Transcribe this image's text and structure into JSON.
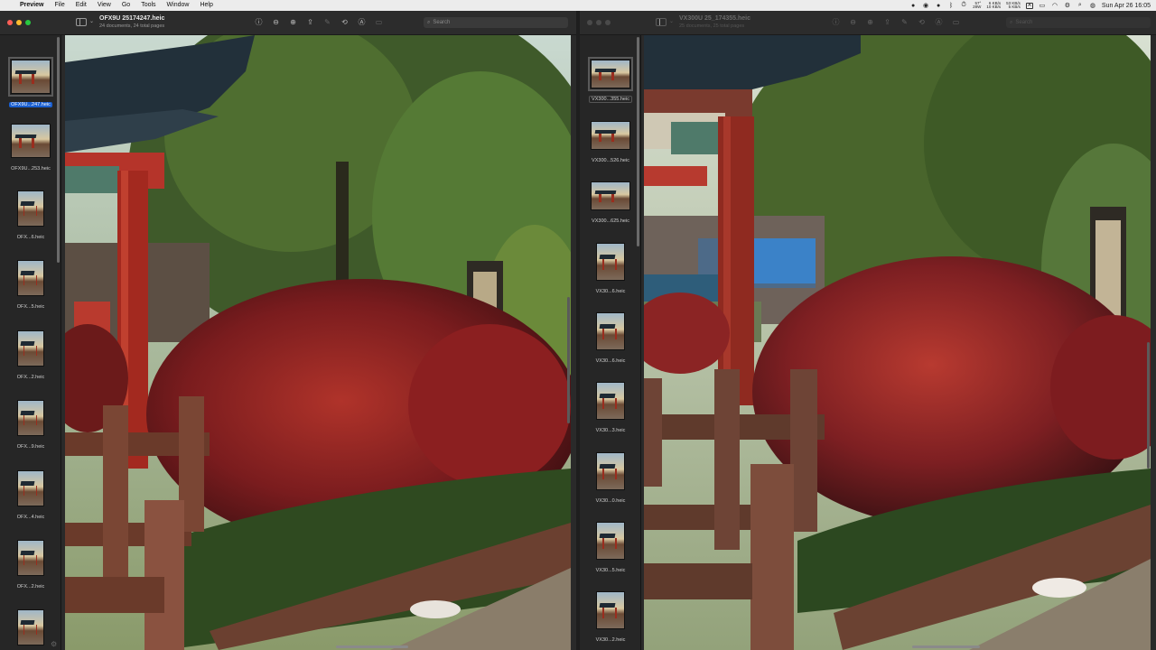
{
  "menubar": {
    "apple_icon": "apple-icon",
    "app_name": "Preview",
    "items": [
      "File",
      "Edit",
      "View",
      "Go",
      "Tools",
      "Window",
      "Help"
    ],
    "status": {
      "cpu_top": "57°",
      "cpu_bottom": "28W",
      "net1_top": "6 KB/s",
      "net1_bottom": "10 KB/s",
      "net2_top": "53 KB/s",
      "net2_bottom": "5 KB/s",
      "lang": "A",
      "clock": "Sun Apr 26  16:05"
    }
  },
  "left_window": {
    "title": "OFX9U 25174247.heic",
    "subtitle": "24 documents, 24 total pages",
    "search_placeholder": "Search",
    "thumbnails": [
      {
        "label": "OFX9U...247.heic",
        "orientation": "land",
        "selected": true
      },
      {
        "label": "OFX9U...253.heic",
        "orientation": "land",
        "selected": false
      },
      {
        "label": "OFX...6.heic",
        "orientation": "port",
        "selected": false
      },
      {
        "label": "OFX...5.heic",
        "orientation": "port",
        "selected": false
      },
      {
        "label": "OFX...2.heic",
        "orientation": "port",
        "selected": false
      },
      {
        "label": "OFX...9.heic",
        "orientation": "port",
        "selected": false
      },
      {
        "label": "OFX...4.heic",
        "orientation": "port",
        "selected": false
      },
      {
        "label": "OFX...2.heic",
        "orientation": "port",
        "selected": false
      },
      {
        "label": "",
        "orientation": "port",
        "selected": false
      }
    ]
  },
  "right_window": {
    "title": "VX300U 25_174355.heic",
    "subtitle": "25 documents, 25 total pages",
    "search_placeholder": "Search",
    "thumbnails": [
      {
        "label": "VX300...355.heic",
        "orientation": "land",
        "selected": true
      },
      {
        "label": "VX300...526.heic",
        "orientation": "land",
        "selected": false
      },
      {
        "label": "VX300...625.heic",
        "orientation": "land",
        "selected": false
      },
      {
        "label": "VX30...6.heic",
        "orientation": "port",
        "selected": false
      },
      {
        "label": "VX30...6.heic",
        "orientation": "port",
        "selected": false
      },
      {
        "label": "VX30...3.heic",
        "orientation": "port",
        "selected": false
      },
      {
        "label": "VX30...0.heic",
        "orientation": "port",
        "selected": false
      },
      {
        "label": "VX30...5.heic",
        "orientation": "port",
        "selected": false
      },
      {
        "label": "VX30...2.heic",
        "orientation": "port",
        "selected": false
      }
    ]
  },
  "toolbar_icons": [
    "info-icon",
    "zoom-out-icon",
    "zoom-in-icon",
    "share-icon",
    "markup-icon",
    "rotate-icon",
    "annotate-icon",
    "form-icon",
    "search-icon"
  ]
}
